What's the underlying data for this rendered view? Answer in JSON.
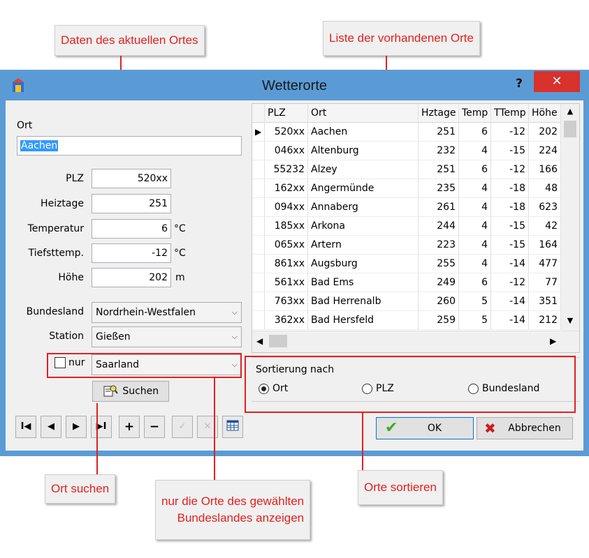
{
  "callouts": {
    "current_location": "Daten des aktuellen Ortes",
    "location_list": "Liste der vorhandenen Orte",
    "search_location": "Ort suchen",
    "state_filter_line1": "nur die Orte des gewählten",
    "state_filter_line2": "Bundeslandes anzeigen",
    "sort_locations": "Orte sortieren"
  },
  "window": {
    "title": "Wetterorte",
    "help": "?",
    "close": "✕"
  },
  "form": {
    "ort_label": "Ort",
    "ort_value": "Aachen",
    "plz_label": "PLZ",
    "plz_value": "520xx",
    "heiztage_label": "Heiztage",
    "heiztage_value": "251",
    "temperatur_label": "Temperatur",
    "temperatur_value": "6",
    "temperatur_unit": "°C",
    "tiefsttemp_label": "Tiefsttemp.",
    "tiefsttemp_value": "-12",
    "tiefsttemp_unit": "°C",
    "hoehe_label": "Höhe",
    "hoehe_value": "202",
    "hoehe_unit": "m",
    "bundesland_label": "Bundesland",
    "bundesland_value": "Nordrhein-Westfalen",
    "station_label": "Station",
    "station_value": "Gießen",
    "nur_label": "nur",
    "filter_value": "Saarland",
    "search_button": "Suchen"
  },
  "table": {
    "headers": [
      "",
      "PLZ",
      "Ort",
      "Hztage",
      "Temp",
      "TTemp",
      "Höhe"
    ],
    "rows": [
      [
        "▶",
        "520xx",
        "Aachen",
        "251",
        "6",
        "-12",
        "202"
      ],
      [
        "",
        "046xx",
        "Altenburg",
        "232",
        "4",
        "-15",
        "224"
      ],
      [
        "",
        "55232",
        "Alzey",
        "251",
        "6",
        "-12",
        "166"
      ],
      [
        "",
        "162xx",
        "Angermünde",
        "235",
        "4",
        "-18",
        "48"
      ],
      [
        "",
        "094xx",
        "Annaberg",
        "261",
        "4",
        "-18",
        "623"
      ],
      [
        "",
        "185xx",
        "Arkona",
        "244",
        "4",
        "-15",
        "42"
      ],
      [
        "",
        "065xx",
        "Artern",
        "223",
        "4",
        "-15",
        "164"
      ],
      [
        "",
        "861xx",
        "Augsburg",
        "255",
        "4",
        "-14",
        "477"
      ],
      [
        "",
        "561xx",
        "Bad Ems",
        "249",
        "6",
        "-12",
        "77"
      ],
      [
        "",
        "763xx",
        "Bad Herrenalb",
        "260",
        "5",
        "-14",
        "351"
      ],
      [
        "",
        "362xx",
        "Bad Hersfeld",
        "259",
        "5",
        "-14",
        "212"
      ]
    ]
  },
  "sort": {
    "group_label": "Sortierung nach",
    "options": [
      "Ort",
      "PLZ",
      "Bundesland"
    ],
    "selected": "Ort"
  },
  "nav": {
    "first": "I◀",
    "prev": "◀",
    "next": "▶",
    "last": "▶I",
    "add": "+",
    "remove": "−",
    "confirm": "✓",
    "cancel_edit": "✕"
  },
  "buttons": {
    "ok": "OK",
    "abbrechen": "Abbrechen"
  },
  "colors": {
    "accent_red": "#e41f1f",
    "title_bar": "#5b9bd5",
    "close_button": "#d9312c",
    "ok_check": "#3cae1f",
    "cancel_x": "#d21a1a"
  }
}
